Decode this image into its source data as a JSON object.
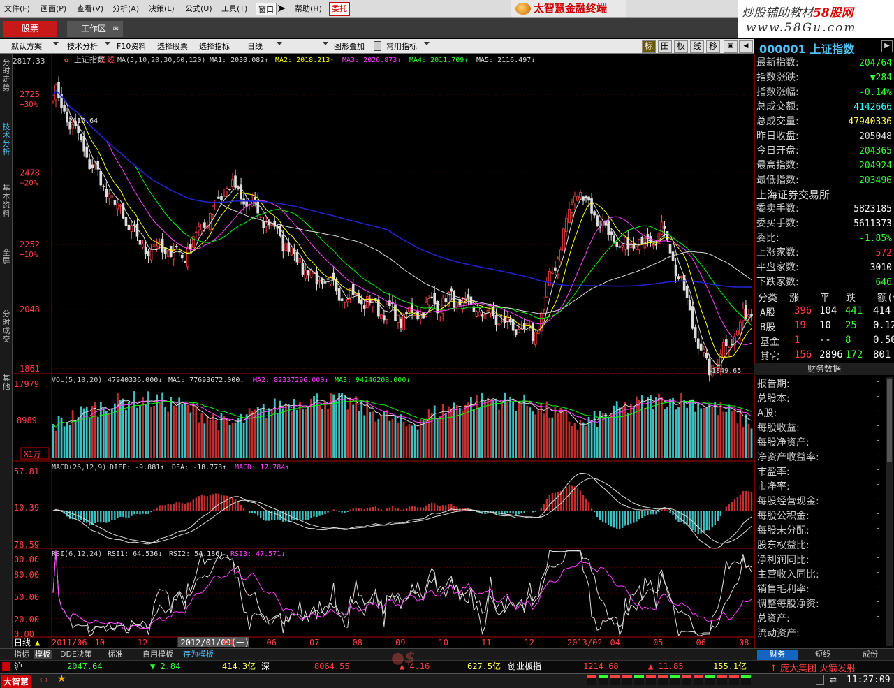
{
  "menu": {
    "items": [
      "文件(F)",
      "画面(P)",
      "查看(V)",
      "分析(A)",
      "决策(L)",
      "公式(U)",
      "工具(T)",
      "窗口",
      "帮助(H)"
    ],
    "weituo": "委托",
    "brand": "太智慧金融终端"
  },
  "watermark": {
    "line1": "炒股辅助教材",
    "line1b": "58股网",
    "line2": "www.58Gu.com"
  },
  "tabs": {
    "stock": "股票",
    "workspace": "工作区"
  },
  "toolbar": {
    "items": [
      "默认方案",
      "技术分析",
      "F10资料",
      "选择股票",
      "选择指标",
      "日线",
      "图形叠加",
      "常用指标"
    ],
    "right_buttons": [
      "标",
      "田",
      "权",
      "线",
      "移"
    ]
  },
  "left_tabs": [
    "分时走势",
    "技术分析",
    "基本资料",
    "全屏",
    "分时成交",
    "其他"
  ],
  "stock": {
    "code": "000001",
    "name": "上证指数"
  },
  "quote": [
    {
      "k": "最新指数:",
      "v": "204764",
      "c": "#33ff33"
    },
    {
      "k": "指数涨跌:",
      "v": "▼284",
      "c": "#33ff33"
    },
    {
      "k": "指数涨幅:",
      "v": "-0.14%",
      "c": "#33ff33"
    },
    {
      "k": "总成交额:",
      "v": "4142666",
      "c": "#33ffff"
    },
    {
      "k": "总成交量:",
      "v": "47940336",
      "c": "#ffff55"
    },
    {
      "k": "昨日收盘:",
      "v": "205048",
      "c": "#dddddd"
    },
    {
      "k": "今日开盘:",
      "v": "204365",
      "c": "#33ff33"
    },
    {
      "k": "最高指数:",
      "v": "204924",
      "c": "#33ff33"
    },
    {
      "k": "最低指数:",
      "v": "203496",
      "c": "#33ff33"
    }
  ],
  "exchange": {
    "title": "上海证券交易所",
    "rows": [
      {
        "k": "委卖手数:",
        "v": "5823185",
        "c": "#ffffff"
      },
      {
        "k": "委买手数:",
        "v": "5611373",
        "c": "#ffffff"
      },
      {
        "k": "委比:",
        "v": "-1.85%",
        "c": "#33ff33"
      },
      {
        "k": "上涨家数:",
        "v": "572",
        "c": "#ff4040"
      },
      {
        "k": "平盘家数:",
        "v": "3010",
        "c": "#ffffff"
      },
      {
        "k": "下跌家数:",
        "v": "646",
        "c": "#33ff33"
      }
    ]
  },
  "breakdown": {
    "headers": [
      "分类",
      "涨",
      "平",
      "跌",
      "额(亿"
    ],
    "rows": [
      {
        "name": "A股",
        "up": "396",
        "flat": "104",
        "down": "441",
        "amt": "414"
      },
      {
        "name": "B股",
        "up": "19",
        "flat": "10",
        "down": "25",
        "amt": "0.123"
      },
      {
        "name": "基金",
        "up": "1",
        "flat": "--",
        "down": "8",
        "amt": "0.509"
      },
      {
        "name": "其它",
        "up": "156",
        "flat": "2896",
        "down": "172",
        "amt": "801"
      }
    ]
  },
  "financial": {
    "title": "财务数据",
    "rows": [
      "报告期:",
      "总股本:",
      "A股:",
      "每股收益:",
      "每股净资产:",
      "净资产收益率:",
      "市盈率:",
      "市净率:",
      "每股经营现金:",
      "每股公积金:",
      "每股未分配:",
      "股东权益比:",
      "净利润同比:",
      "主营收入同比:",
      "销售毛利率:",
      "调整每股净资:",
      "总资产:",
      "流动资产:"
    ],
    "dash": "-"
  },
  "price_panel": {
    "top_label": "2817.33",
    "title": "上证指数",
    "period": "日线",
    "ma_header": "MA(5,10,20,30,60,120)",
    "ma1": "MA1: 2030.082↑",
    "ma2": "MA2: 2018.213↑",
    "ma3": "MA3: 2026.873↑",
    "ma4": "MA4: 2011.709↑",
    "ma5": "MA5: 2116.497↓",
    "yticks": [
      {
        "v": "2725",
        "p": "+30%"
      },
      {
        "v": "2478",
        "p": "+20%"
      },
      {
        "v": "2252",
        "p": "+10%"
      },
      {
        "v": "2048",
        "p": ""
      },
      {
        "v": "1861",
        "p": ""
      }
    ],
    "high_label": "2616.64",
    "low_label": "←1849.65"
  },
  "vol_panel": {
    "header": "VOL(5,10,20)",
    "val": "47940336.000↓",
    "ma1": "MA1: 77693672.000↓",
    "ma2": "MA2: 82337296.000↓",
    "ma3": "MA3: 94246208.000↓",
    "ticks": [
      "17979",
      "8989"
    ],
    "unit": "X1万"
  },
  "macd_panel": {
    "header": "MACD(26,12,9)",
    "diff": "DIFF: -9.881↑",
    "dea": "DEA: -18.773↑",
    "macd": "MACD: 17.784↑",
    "ticks": [
      "57.81",
      "10.39",
      "78.59"
    ]
  },
  "rsi_panel": {
    "header": "RSI(6,12,24)",
    "rsi1": "RSI1: 64.536↓",
    "rsi2": "RSI2: 54.186↓",
    "rsi3": "RSI3: 47.571↓",
    "ticks": [
      "00.00",
      "80.00",
      "50.00",
      "20.00",
      "0.00"
    ]
  },
  "xaxis": {
    "period_label": "日线",
    "labels": [
      "2011/06",
      "10",
      "12",
      "2012/01/09(一)",
      "04",
      "06",
      "07",
      "08",
      "09",
      "10",
      "11",
      "12",
      "2013/02",
      "04",
      "05",
      "06",
      "08"
    ]
  },
  "bottom_tabs": [
    "指标",
    "模板",
    "DDE决策",
    "标准",
    "自用模板",
    "存为模板"
  ],
  "right_bottom_tabs": [
    "财务",
    "短线",
    "成份"
  ],
  "ticker": {
    "sh_label": "沪",
    "sh_val": "2047.64",
    "sh_chg": "▼ 2.84",
    "sh_amt": "414.3亿",
    "sz_label": "深",
    "sz_val": "8064.55",
    "sz_chg": "▲ 4.16",
    "sz_amt": "627.5亿",
    "cy_label": "创业板指",
    "cy_val": "1214.68",
    "cy_chg": "▲ 11.85",
    "cy_amt": "155.1亿",
    "news": "↑ 庞大集团 火箭发射"
  },
  "status": {
    "logo": "大智慧",
    "time": "11:27:09"
  },
  "colors": {
    "up": "#ff4040",
    "down": "#33ff33",
    "ma_white": "#dddddd",
    "ma_yellow": "#ffff00",
    "ma_magenta": "#ff40ff",
    "ma_green": "#00ff00",
    "ma_blue": "#2222cc"
  },
  "chart_data": {
    "type": "line",
    "title": "上证指数",
    "x": [
      "2011/06",
      "2011/10",
      "2011/12",
      "2012/01",
      "2012/04",
      "2012/06",
      "2012/07",
      "2012/08",
      "2012/09",
      "2012/10",
      "2012/11",
      "2012/12",
      "2013/02",
      "2013/04",
      "2013/05",
      "2013/06",
      "2013/08"
    ],
    "series": [
      {
        "name": "上证指数",
        "values": [
          2740,
          2470,
          2250,
          2220,
          2440,
          2310,
          2140,
          2080,
          2020,
          2080,
          2030,
          1960,
          2430,
          2230,
          2300,
          1850,
          2050
        ]
      }
    ],
    "ylim": [
      1849.65,
      2817.33
    ],
    "annotations": [
      "2616.64",
      "1849.65"
    ]
  }
}
